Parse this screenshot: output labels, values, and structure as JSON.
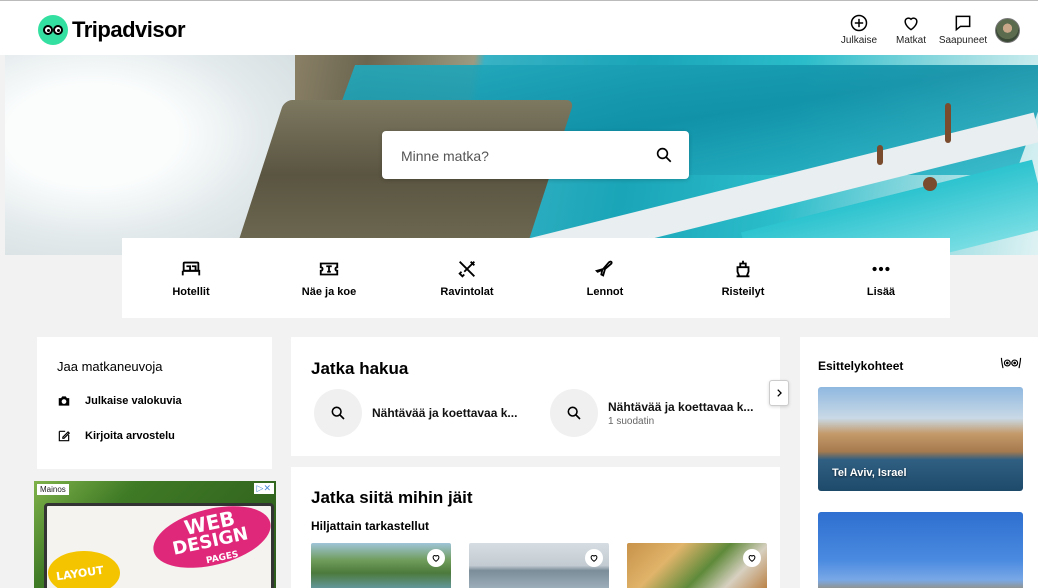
{
  "brand": {
    "name": "Tripadvisor"
  },
  "header": {
    "nav": [
      {
        "label": "Julkaise",
        "icon": "plus-circle-icon"
      },
      {
        "label": "Matkat",
        "icon": "heart-icon"
      },
      {
        "label": "Saapuneet",
        "icon": "chat-bubble-icon"
      }
    ]
  },
  "search": {
    "placeholder": "Minne matka?"
  },
  "categories": [
    {
      "label": "Hotellit",
      "icon": "bed-icon"
    },
    {
      "label": "Näe ja koe",
      "icon": "ticket-icon"
    },
    {
      "label": "Ravintolat",
      "icon": "fork-knife-icon"
    },
    {
      "label": "Lennot",
      "icon": "plane-icon"
    },
    {
      "label": "Risteilyt",
      "icon": "ship-icon"
    },
    {
      "label": "Lisää",
      "icon": "more-dots-icon"
    }
  ],
  "share": {
    "title": "Jaa matkaneuvoja",
    "items": [
      {
        "label": "Julkaise valokuvia",
        "icon": "camera-icon"
      },
      {
        "label": "Kirjoita arvostelu",
        "icon": "edit-icon"
      }
    ]
  },
  "ad": {
    "label": "Mainos",
    "close": "▷✕",
    "word1": "WEB",
    "word2": "DESIGN",
    "word3": "PAGES",
    "word4": "LAYOUT"
  },
  "continue_search": {
    "title": "Jatka hakua",
    "items": [
      {
        "text": "Nähtävää ja koettavaa k...",
        "sub": ""
      },
      {
        "text": "Nähtävää ja koettavaa k...",
        "sub": "1 suodatin"
      }
    ]
  },
  "resume": {
    "title": "Jatka siitä mihin jäit",
    "subtitle": "Hiljattain tarkastellut"
  },
  "featured": {
    "title": "Esittelykohteet",
    "cards": [
      {
        "label": "Tel Aviv, Israel"
      },
      {
        "label": ""
      }
    ]
  }
}
